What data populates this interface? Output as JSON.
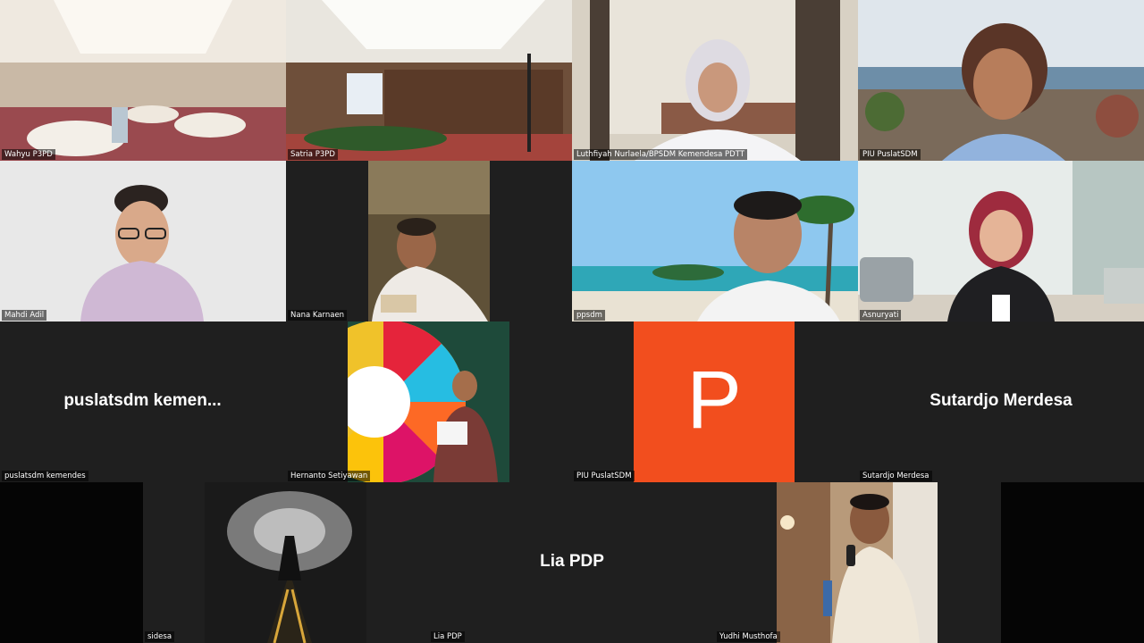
{
  "participants": [
    {
      "name": "Wahyu P3PD"
    },
    {
      "name": "Satria P3PD"
    },
    {
      "name": "Luthfiyah Nurlaela/BPSDM Kemendesa PDTT"
    },
    {
      "name": "PIU PuslatSDM"
    },
    {
      "name": "Mahdi Adil"
    },
    {
      "name": "Nana Karnaen"
    },
    {
      "name": "ppsdm"
    },
    {
      "name": "Asnuryati"
    },
    {
      "name": "puslatsdm kemendes",
      "display": "puslatsdm  kemen..."
    },
    {
      "name": "Hernanto Setiyawan"
    },
    {
      "name": "PIU PuslatSDM",
      "avatar_letter": "P"
    },
    {
      "name": "Sutardjo Merdesa",
      "display": "Sutardjo Merdesa"
    },
    {
      "name": "sidesa"
    },
    {
      "name": "Lia PDP",
      "display": "Lia PDP"
    },
    {
      "name": "Yudhi Musthofa"
    }
  ],
  "colors": {
    "background": "#1c1c1c",
    "tile": "#1f1f1f",
    "avatar_orange": "#f24e1e"
  }
}
